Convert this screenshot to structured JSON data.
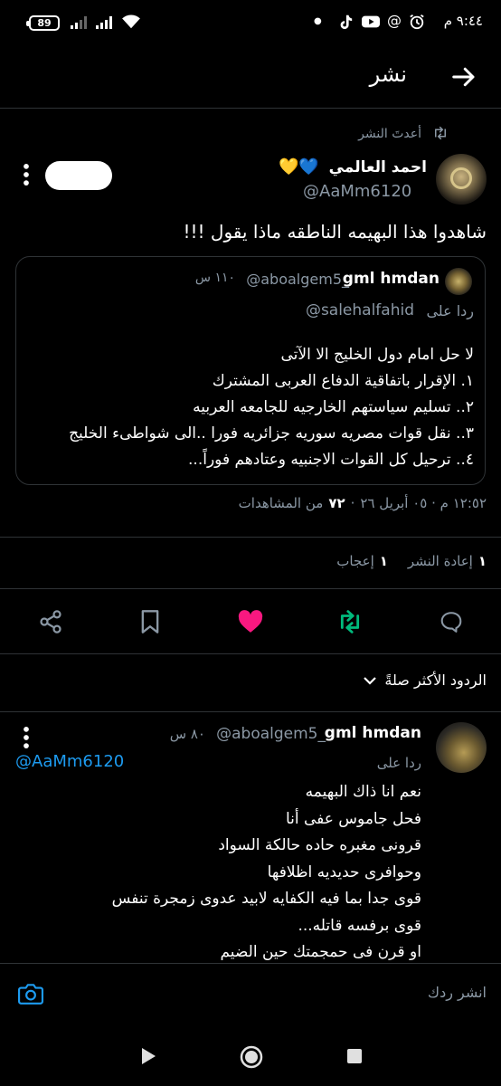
{
  "status_bar": {
    "time": "٩:٤٤ م",
    "battery": "89",
    "icons": [
      "clock-icon",
      "at-icon",
      "youtube-icon",
      "tiktok-icon",
      "dot-icon",
      "wifi-icon",
      "signal-icon",
      "signal-icon"
    ]
  },
  "header": {
    "title": "نشر",
    "back_icon": "arrow-right-icon"
  },
  "retweet_context": {
    "label": "أعدتَ النشر",
    "icon": "retweet-icon"
  },
  "tweet": {
    "author_name": "احمد العالمي",
    "emojis": "💛💙",
    "handle": "@AaMm6120",
    "text": "شاهدوا هذا البهيمه الناطقه ماذا يقول !!!",
    "quote": {
      "author_name": "gml hmdan",
      "handle": "@aboalgem5_",
      "time": "١١٠ س",
      "reply_to_label": "ردا على",
      "reply_to_handle": "@salehalfahid",
      "lines": [
        "لا حل امام دول الخليج الا الآتى",
        "١. الإقرار باتفاقية الدفاع العربى المشترك",
        "٢.. تسليم سياستهم الخارجيه للجامعه العربيه",
        "٣.. نقل قوات مصريه سوريه جزائريه فورا ..الى شواطىء الخليج",
        "٤.. ترحيل كل القوات الاجنبيه وعتادهم فوراً..."
      ]
    },
    "meta_time": "١٢:٥٢ م · ٠٥ أبريل ٢٦",
    "meta_views_count": "٧٢",
    "meta_views_label": "من المشاهدات",
    "retweet_count": "١",
    "retweet_label": "إعادة النشر",
    "like_count": "١",
    "like_label": "إعجاب"
  },
  "actions": {
    "reply_icon": "reply-icon",
    "retweet_icon": "retweet-icon",
    "like_icon": "heart-icon",
    "bookmark_icon": "bookmark-icon",
    "share_icon": "share-icon"
  },
  "colors": {
    "like": "#f91880",
    "retweet": "#00ba7c",
    "link": "#1d9bf0",
    "muted": "#8b98a5"
  },
  "sort_label": "الردود الأكثر صلةً",
  "reply": {
    "author_name": "gml hmdan",
    "handle": "@aboalgem5_",
    "time": "٨٠ س",
    "reply_to_label": "ردا على",
    "reply_to_handle": "@AaMm6120",
    "lines": [
      "نعم انا ذاك البهيمه",
      "فحل جاموس عفى أنا",
      "قرونى مغبره حاده حالكة السواد",
      "وحوافرى حديديه اظلافها",
      "قوى  جدا بما فيه الكفايه لابيد عدوى زمجرة تنفس",
      "قوى برفسه قاتله...",
      "او قرن فى حمجمتك حين الضيم"
    ]
  },
  "composer": {
    "placeholder": "انشر ردك"
  },
  "nav": {
    "back": "triangle-back-icon",
    "home": "circle-home-icon",
    "recents": "square-recents-icon"
  }
}
